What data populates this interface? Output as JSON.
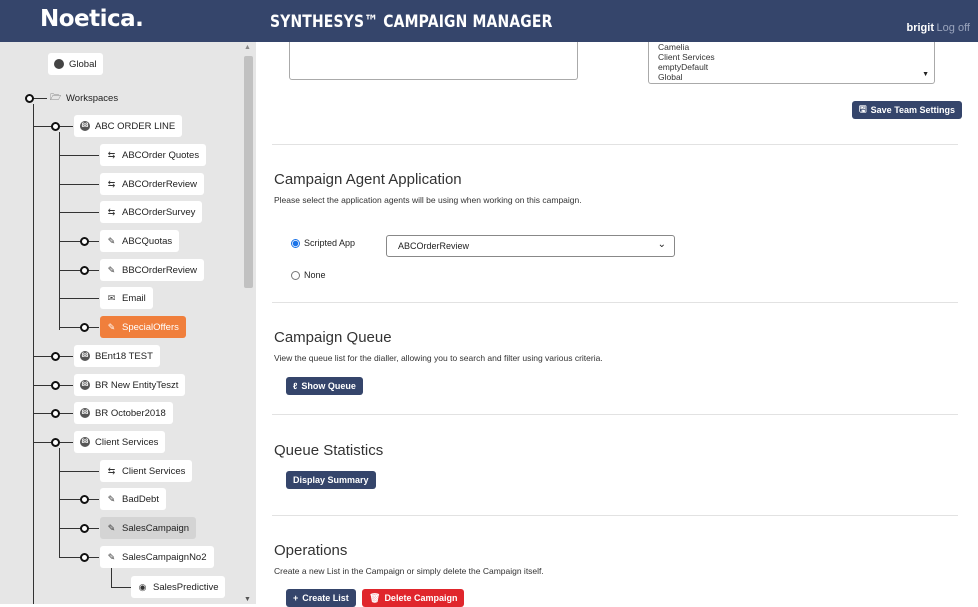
{
  "header": {
    "brand": "Noetica.",
    "app_title": "SYNTHESYS™ CAMPAIGN MANAGER",
    "user": "brigit",
    "logoff": "Log off"
  },
  "sidebar": {
    "global": "Global",
    "workspaces": "Workspaces",
    "abc_order_line": "ABC ORDER LINE",
    "abc_children": [
      "ABCOrder Quotes",
      "ABCOrderReview",
      "ABCOrderSurvey",
      "ABCQuotas",
      "BBCOrderReview",
      "Email",
      "SpecialOffers"
    ],
    "bent18": "BEnt18 TEST",
    "br_new": "BR New EntityTeszt",
    "br_oct": "BR October2018",
    "client_services": "Client Services",
    "cs_children": [
      "Client Services",
      "BadDebt",
      "SalesCampaign",
      "SalesCampaignNo2"
    ],
    "sales_predictive": "SalesPredictive"
  },
  "team": {
    "list_items": [
      "Camelia",
      "Client Services",
      "emptyDefault",
      "Global"
    ],
    "save_label": "Save Team Settings"
  },
  "agent_app": {
    "title": "Campaign Agent Application",
    "description": "Please select the application agents will be using when working on this campaign.",
    "scripted_label": "Scripted App",
    "selected_app": "ABCOrderReview",
    "none_label": "None"
  },
  "queue": {
    "title": "Campaign Queue",
    "description": "View the queue list for the dialler, allowing you to search and filter using various criteria.",
    "button": "Show Queue"
  },
  "stats": {
    "title": "Queue Statistics",
    "button": "Display Summary"
  },
  "operations": {
    "title": "Operations",
    "description": "Create a new List in the Campaign or simply delete the Campaign itself.",
    "create_label": "Create List",
    "delete_label": "Delete Campaign"
  },
  "colors": {
    "header": "#35456b",
    "active_node": "#f07f3c",
    "danger": "#e0262c"
  }
}
